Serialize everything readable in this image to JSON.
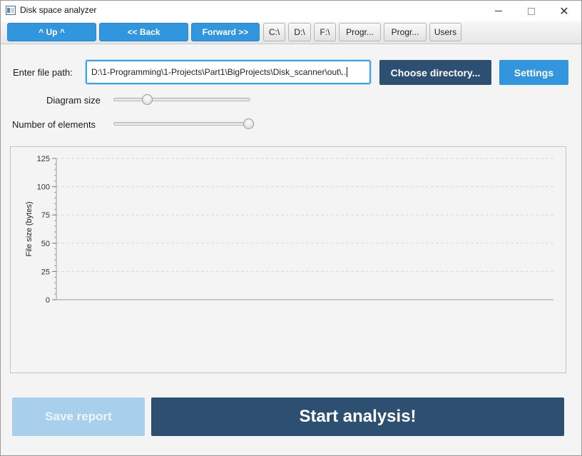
{
  "window": {
    "title": "Disk space analyzer"
  },
  "toolbar": {
    "up_label": "^ Up ^",
    "back_label": "<< Back",
    "forward_label": "Forward >>",
    "drive_c": "C:\\",
    "drive_d": "D:\\",
    "drive_f": "F:\\",
    "progr1": "Progr...",
    "progr2": "Progr...",
    "users": "Users"
  },
  "path": {
    "label": "Enter file path:",
    "value": "D:\\1-Programming\\1-Projects\\Part1\\BigProjects\\Disk_scanner\\out\\.."
  },
  "buttons": {
    "choose_directory": "Choose directory...",
    "settings": "Settings",
    "save_report": "Save report",
    "start_analysis": "Start analysis!"
  },
  "sliders": {
    "diagram_size": {
      "label": "Diagram size",
      "value_fraction": 0.25
    },
    "number_of_elements": {
      "label": "Number of elements",
      "value_fraction": 1.0
    }
  },
  "colors": {
    "accent_blue": "#3296de",
    "dark_blue": "#2c4f72",
    "disabled_blue": "#a8d0ed"
  },
  "chart_data": {
    "type": "bar",
    "categories": [],
    "values": [],
    "title": "",
    "xlabel": "",
    "ylabel": "File size (bytes)",
    "ylim": [
      0,
      125
    ],
    "yticks": [
      0,
      25,
      50,
      75,
      100,
      125
    ],
    "grid": true
  }
}
